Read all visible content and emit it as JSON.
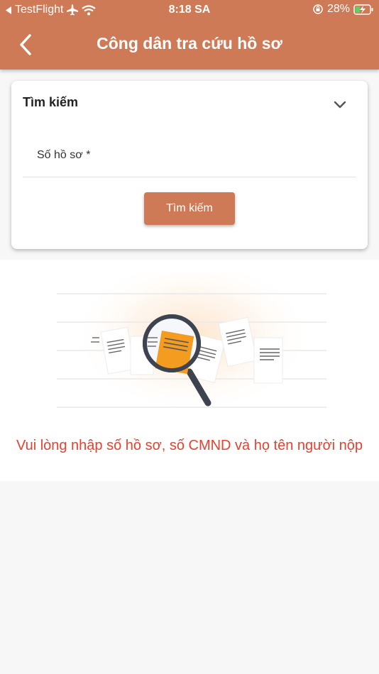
{
  "status_bar": {
    "carrier": "TestFlight",
    "time": "8:18 SA",
    "battery": "28%"
  },
  "header": {
    "title": "Công dân tra cứu hồ sơ",
    "back_icon": "chevron-left-icon"
  },
  "search_card": {
    "title": "Tìm kiếm",
    "toggle_icon": "chevron-down-icon",
    "fields": [
      {
        "label": "Số hồ sơ *",
        "value": ""
      }
    ],
    "search_button": "Tìm kiếm"
  },
  "empty_state": {
    "illustration": "magnifier-documents-icon",
    "message": "Vui lòng nhập số hồ sơ, số CMND và họ tên người nộp"
  },
  "colors": {
    "primary": "#cf7a57",
    "error_text": "#e8412f",
    "background": "#f7f7f7"
  }
}
